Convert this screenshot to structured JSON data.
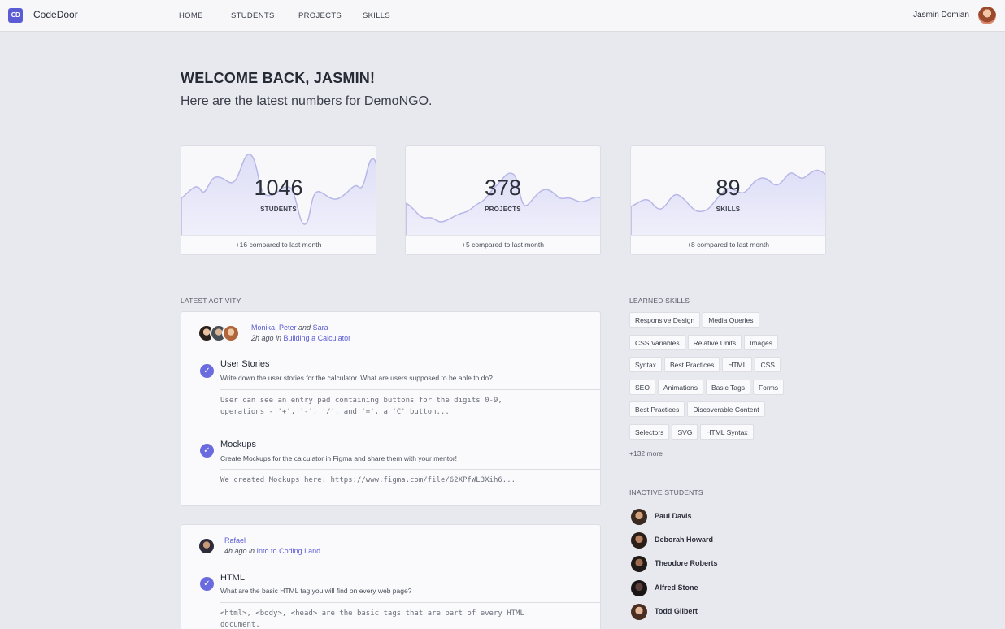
{
  "nav": {
    "logo_text": "CD",
    "brand": "CodeDoor",
    "links": [
      "HOME",
      "STUDENTS",
      "PROJECTS",
      "SKILLS"
    ],
    "user_name": "Jasmin Domian"
  },
  "welcome": {
    "title": "WELCOME BACK, JASMIN!",
    "subtitle": "Here are the latest numbers for DemoNGO."
  },
  "stats": [
    {
      "value": "1046",
      "label": "STUDENTS",
      "footer": "+16 compared to last month"
    },
    {
      "value": "378",
      "label": "PROJECTS",
      "footer": "+5 compared to last month"
    },
    {
      "value": "89",
      "label": "SKILLS",
      "footer": "+8 compared to last month"
    }
  ],
  "activity": {
    "heading": "LATEST ACTIVITY",
    "entries": [
      {
        "people": "Monika, Peter",
        "and": "and",
        "last": "Sara",
        "time": "2h ago in ",
        "project": "Building a Calculator",
        "tasks": [
          {
            "title": "User Stories",
            "desc": "Write down the user stories for the calculator. What are users supposed to be able to do?",
            "answer": "User can see an entry pad containing buttons for the digits 0-9,\noperations - '+', '-', '/', and '=', a 'C' button..."
          },
          {
            "title": "Mockups",
            "desc": "Create Mockups for the calculator in Figma and share them with your mentor!",
            "answer": "We created Mockups here: https://www.figma.com/file/62XPfWL3Xih6..."
          }
        ]
      },
      {
        "people": "Rafael",
        "time": "4h ago in ",
        "project": "Into to Coding Land",
        "tasks": [
          {
            "title": "HTML",
            "desc": "What are the basic HTML tag you will find on every web page?",
            "answer": "<html>, <body>, <head> are the basic tags that are part of every HTML\ndocument."
          }
        ]
      }
    ]
  },
  "skills": {
    "heading": "LEARNED SKILLS",
    "tags": [
      "Responsive Design",
      "Media Queries",
      "CSS Variables",
      "Relative Units",
      "Images",
      "Syntax",
      "Best Practices",
      "HTML",
      "CSS",
      "SEO",
      "Animations",
      "Basic Tags",
      "Forms",
      "Best Practices",
      "Discoverable Content",
      "Selectors",
      "SVG",
      "HTML Syntax"
    ],
    "more": "+132 more"
  },
  "inactive": {
    "heading": "INACTIVE STUDENTS",
    "students": [
      "Paul Davis",
      "Deborah Howard",
      "Theodore Roberts",
      "Alfred Stone",
      "Todd Gilbert"
    ]
  },
  "colors": {
    "accent": "#5b5bd6",
    "wave_fill": "#e6e6f8",
    "wave_stroke": "#b7b7e8"
  }
}
